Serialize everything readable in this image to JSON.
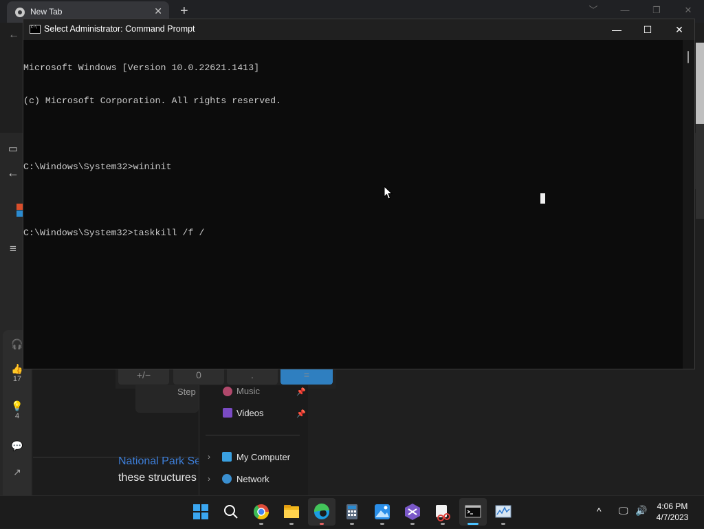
{
  "chrome": {
    "tab_title": "New Tab",
    "tab_close": "✕",
    "new_tab": "+",
    "controls": [
      "﹀",
      "—",
      "❐",
      "✕"
    ],
    "back": "←"
  },
  "background_page": {
    "like_count": "17",
    "idea_count": "4",
    "article_link": "National Park Se",
    "article_text": "these structures",
    "calc_keys": [
      "+/−",
      "0",
      ".",
      "="
    ],
    "steps_label": "Step"
  },
  "explorer": {
    "items": [
      {
        "label": "Music",
        "pinned": true
      },
      {
        "label": "Videos",
        "pinned": true
      },
      {
        "label": "My Computer",
        "pinned": false
      },
      {
        "label": "Network",
        "pinned": false
      }
    ]
  },
  "cmd": {
    "title": "Select Administrator:  Command Prompt",
    "controls": {
      "minimize": "—",
      "maximize": "☐",
      "close": "✕"
    },
    "lines": [
      "Microsoft Windows [Version 10.0.22621.1413]",
      "(c) Microsoft Corporation. All rights reserved.",
      "",
      "C:\\Windows\\System32>wininit",
      "",
      "C:\\Windows\\System32>taskkill /f /"
    ]
  },
  "taskbar": {
    "apps": [
      {
        "icon": "windows-start-icon"
      },
      {
        "icon": "search-icon"
      },
      {
        "icon": "chrome-icon"
      },
      {
        "icon": "file-explorer-icon"
      },
      {
        "icon": "edge-icon"
      },
      {
        "icon": "calculator-icon"
      },
      {
        "icon": "photos-icon"
      },
      {
        "icon": "visual-studio-icon"
      },
      {
        "icon": "snipping-tool-icon"
      },
      {
        "icon": "command-prompt-icon"
      },
      {
        "icon": "resource-monitor-icon"
      }
    ],
    "tray": {
      "chevron": "^",
      "time": "4:06 PM",
      "date": "4/7/2023"
    }
  }
}
